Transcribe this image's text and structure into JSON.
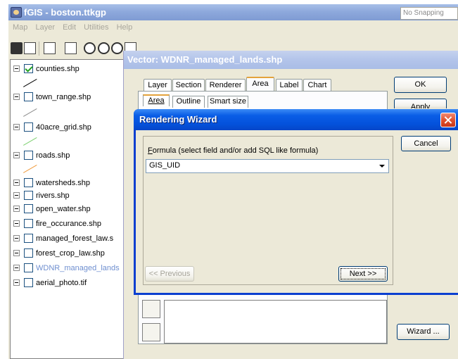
{
  "app": {
    "title": "fGIS - boston.ttkgp",
    "menu": [
      "Map",
      "Layer",
      "Edit",
      "Utilities",
      "Help"
    ],
    "snapping_value": "No Snapping"
  },
  "layers": [
    {
      "name": "counties.shp",
      "checked": true,
      "legend_color": "#000000"
    },
    {
      "name": "town_range.shp",
      "checked": false,
      "legend_color": "#8c8c8c"
    },
    {
      "name": "40acre_grid.shp",
      "checked": false,
      "legend_color": "#7cd06f"
    },
    {
      "name": "roads.shp",
      "checked": false,
      "legend_color": "#f09a3c"
    },
    {
      "name": "watersheds.shp",
      "checked": false
    },
    {
      "name": "rivers.shp",
      "checked": false
    },
    {
      "name": "open_water.shp",
      "checked": false
    },
    {
      "name": "fire_occurance.shp",
      "checked": false
    },
    {
      "name": "managed_forest_law.s",
      "checked": false
    },
    {
      "name": "forest_crop_law.shp",
      "checked": false
    },
    {
      "name": "WDNR_managed_lands",
      "checked": false,
      "selected": true
    },
    {
      "name": "aerial_photo.tif",
      "checked": false
    }
  ],
  "vector_dialog": {
    "title": "Vector: WDNR_managed_lands.shp",
    "tabs": [
      "Layer",
      "Section",
      "Renderer",
      "Area",
      "Label",
      "Chart"
    ],
    "active_tab": "Area",
    "subtabs": [
      "Area",
      "Outline",
      "Smart size"
    ],
    "ok_label": "OK",
    "apply_label": "Apply",
    "wizard_label": "Wizard ..."
  },
  "wizard": {
    "title": "Rendering Wizard",
    "formula_label_prefix": "F",
    "formula_label_rest": "ormula (select field and/or add SQL like formula)",
    "formula_value": "GIS_UID",
    "cancel_label": "Cancel",
    "prev_label": "<< Previous",
    "next_label": "Next >>"
  }
}
